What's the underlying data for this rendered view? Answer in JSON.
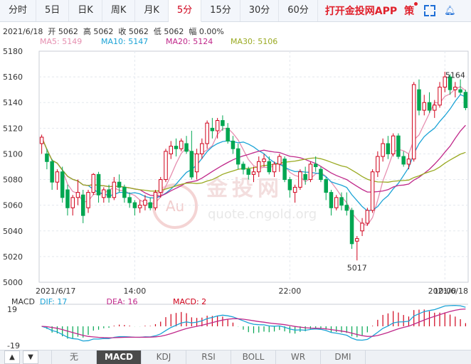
{
  "tabs": [
    {
      "label": "分时",
      "active": false
    },
    {
      "label": "5日",
      "active": false
    },
    {
      "label": "日K",
      "active": false
    },
    {
      "label": "周K",
      "active": false
    },
    {
      "label": "月K",
      "active": false
    },
    {
      "label": "5分",
      "active": true
    },
    {
      "label": "15分",
      "active": false
    },
    {
      "label": "30分",
      "active": false
    },
    {
      "label": "60分",
      "active": false
    }
  ],
  "promo_label": "打开金投网APP",
  "calendar_label": "策",
  "info": {
    "date": "2021/6/18",
    "open_label": "开",
    "open": "5062",
    "high_label": "高",
    "high": "5062",
    "close_label": "收",
    "close": "5062",
    "low_label": "低",
    "low": "5062",
    "amp_label": "幅",
    "amp": "0.00%"
  },
  "ma_legend": [
    {
      "text": "MA5: 5149",
      "color": "#e68fb0"
    },
    {
      "text": "MA10: 5147",
      "color": "#1ba3d6"
    },
    {
      "text": "MA20: 5124",
      "color": "#c0288a"
    },
    {
      "text": "MA30: 5106",
      "color": "#9aaa22"
    }
  ],
  "macd_legend": {
    "macd": {
      "text": "MACD",
      "color": "#333333"
    },
    "dif": {
      "text": "DIF: 17",
      "color": "#1ba3d6"
    },
    "dea": {
      "text": "DEA: 16",
      "color": "#c0288a"
    },
    "val": {
      "text": "MACD: 2",
      "color": "#d0021b"
    }
  },
  "watermark": {
    "cn": "金投网",
    "url": "quote.cngold.org",
    "logo": "Au"
  },
  "indicator_tabs": [
    {
      "label": "无",
      "active": false
    },
    {
      "label": "MACD",
      "active": true
    },
    {
      "label": "KDJ",
      "active": false
    },
    {
      "label": "RSI",
      "active": false
    },
    {
      "label": "BOLL",
      "active": false
    },
    {
      "label": "WR",
      "active": false
    },
    {
      "label": "DMI",
      "active": false
    }
  ],
  "arrows": {
    "up": "▲",
    "down": "▼"
  },
  "colors": {
    "up": "#d0021b",
    "down": "#00a651",
    "grid": "#e4e8ee"
  },
  "chart_data": [
    {
      "type": "candlestick",
      "title": "",
      "ylim": [
        5000,
        5180
      ],
      "y_ticks": [
        5000,
        5020,
        5040,
        5060,
        5080,
        5100,
        5120,
        5140,
        5160,
        5180
      ],
      "x_labels": [
        {
          "label": "2021/6/17",
          "at": 0
        },
        {
          "label": "14:00",
          "at": 18
        },
        {
          "label": "22:00",
          "at": 48
        },
        {
          "label": "10:00",
          "at": 78
        },
        {
          "label": "2021/6/18",
          "at": 98
        }
      ],
      "candles": [
        [
          5108,
          5115,
          5100,
          5113
        ],
        [
          5100,
          5104,
          5088,
          5094
        ],
        [
          5094,
          5096,
          5072,
          5078
        ],
        [
          5078,
          5088,
          5072,
          5086
        ],
        [
          5086,
          5090,
          5062,
          5066
        ],
        [
          5072,
          5076,
          5052,
          5058
        ],
        [
          5058,
          5068,
          5052,
          5066
        ],
        [
          5066,
          5080,
          5060,
          5070
        ],
        [
          5068,
          5072,
          5046,
          5052
        ],
        [
          5058,
          5072,
          5054,
          5070
        ],
        [
          5070,
          5085,
          5068,
          5084
        ],
        [
          5084,
          5086,
          5062,
          5068
        ],
        [
          5066,
          5074,
          5062,
          5072
        ],
        [
          5072,
          5076,
          5062,
          5066
        ],
        [
          5066,
          5082,
          5064,
          5078
        ],
        [
          5078,
          5084,
          5070,
          5074
        ],
        [
          5074,
          5076,
          5062,
          5066
        ],
        [
          5066,
          5070,
          5058,
          5062
        ],
        [
          5062,
          5064,
          5052,
          5058
        ],
        [
          5058,
          5064,
          5054,
          5060
        ],
        [
          5060,
          5068,
          5056,
          5064
        ],
        [
          5062,
          5066,
          5056,
          5058
        ],
        [
          5058,
          5072,
          5056,
          5070
        ],
        [
          5070,
          5082,
          5066,
          5080
        ],
        [
          5080,
          5104,
          5078,
          5102
        ],
        [
          5100,
          5110,
          5096,
          5106
        ],
        [
          5106,
          5112,
          5098,
          5104
        ],
        [
          5104,
          5112,
          5102,
          5110
        ],
        [
          5108,
          5114,
          5100,
          5102
        ],
        [
          5102,
          5118,
          5080,
          5082
        ],
        [
          5086,
          5104,
          5080,
          5100
        ],
        [
          5100,
          5112,
          5096,
          5108
        ],
        [
          5108,
          5126,
          5104,
          5124
        ],
        [
          5120,
          5128,
          5112,
          5118
        ],
        [
          5118,
          5128,
          5112,
          5126
        ],
        [
          5126,
          5130,
          5118,
          5122
        ],
        [
          5120,
          5124,
          5108,
          5110
        ],
        [
          5110,
          5114,
          5100,
          5104
        ],
        [
          5104,
          5108,
          5088,
          5092
        ],
        [
          5092,
          5094,
          5084,
          5088
        ],
        [
          5088,
          5090,
          5080,
          5084
        ],
        [
          5084,
          5090,
          5078,
          5086
        ],
        [
          5086,
          5098,
          5082,
          5094
        ],
        [
          5094,
          5100,
          5090,
          5096
        ],
        [
          5094,
          5098,
          5084,
          5086
        ],
        [
          5086,
          5094,
          5082,
          5092
        ],
        [
          5092,
          5100,
          5086,
          5098
        ],
        [
          5096,
          5098,
          5078,
          5080
        ],
        [
          5080,
          5082,
          5066,
          5072
        ],
        [
          5070,
          5076,
          5062,
          5074
        ],
        [
          5074,
          5088,
          5072,
          5086
        ],
        [
          5084,
          5090,
          5076,
          5080
        ],
        [
          5080,
          5094,
          5078,
          5092
        ],
        [
          5092,
          5098,
          5086,
          5090
        ],
        [
          5088,
          5090,
          5078,
          5080
        ],
        [
          5080,
          5082,
          5064,
          5070
        ],
        [
          5070,
          5072,
          5052,
          5058
        ],
        [
          5058,
          5068,
          5056,
          5066
        ],
        [
          5066,
          5070,
          5056,
          5060
        ],
        [
          5060,
          5070,
          5052,
          5056
        ],
        [
          5056,
          5058,
          5026,
          5030
        ],
        [
          5032,
          5036,
          5017,
          5034
        ],
        [
          5040,
          5050,
          5036,
          5046
        ],
        [
          5046,
          5058,
          5044,
          5056
        ],
        [
          5056,
          5088,
          5054,
          5086
        ],
        [
          5086,
          5102,
          5082,
          5098
        ],
        [
          5098,
          5112,
          5094,
          5108
        ],
        [
          5108,
          5114,
          5096,
          5100
        ],
        [
          5100,
          5116,
          5098,
          5114
        ],
        [
          5114,
          5116,
          5096,
          5098
        ],
        [
          5098,
          5102,
          5090,
          5092
        ],
        [
          5092,
          5100,
          5088,
          5096
        ],
        [
          5096,
          5156,
          5094,
          5154
        ],
        [
          5150,
          5158,
          5130,
          5134
        ],
        [
          5134,
          5146,
          5130,
          5140
        ],
        [
          5140,
          5148,
          5132,
          5134
        ],
        [
          5134,
          5142,
          5128,
          5138
        ],
        [
          5138,
          5156,
          5136,
          5152
        ],
        [
          5152,
          5164,
          5148,
          5160
        ],
        [
          5160,
          5162,
          5146,
          5150
        ],
        [
          5150,
          5156,
          5144,
          5152
        ],
        [
          5150,
          5158,
          5146,
          5148
        ],
        [
          5148,
          5150,
          5134,
          5136
        ]
      ],
      "annotations": [
        {
          "text": "5164",
          "at": 80
        },
        {
          "text": "5017",
          "at": 61
        }
      ]
    },
    {
      "type": "macd",
      "title": "",
      "ylim": [
        -19,
        19
      ],
      "y_ticks": [
        19,
        -19
      ],
      "dif_end": 17,
      "dea_end": 16,
      "macd_end": 2
    }
  ]
}
